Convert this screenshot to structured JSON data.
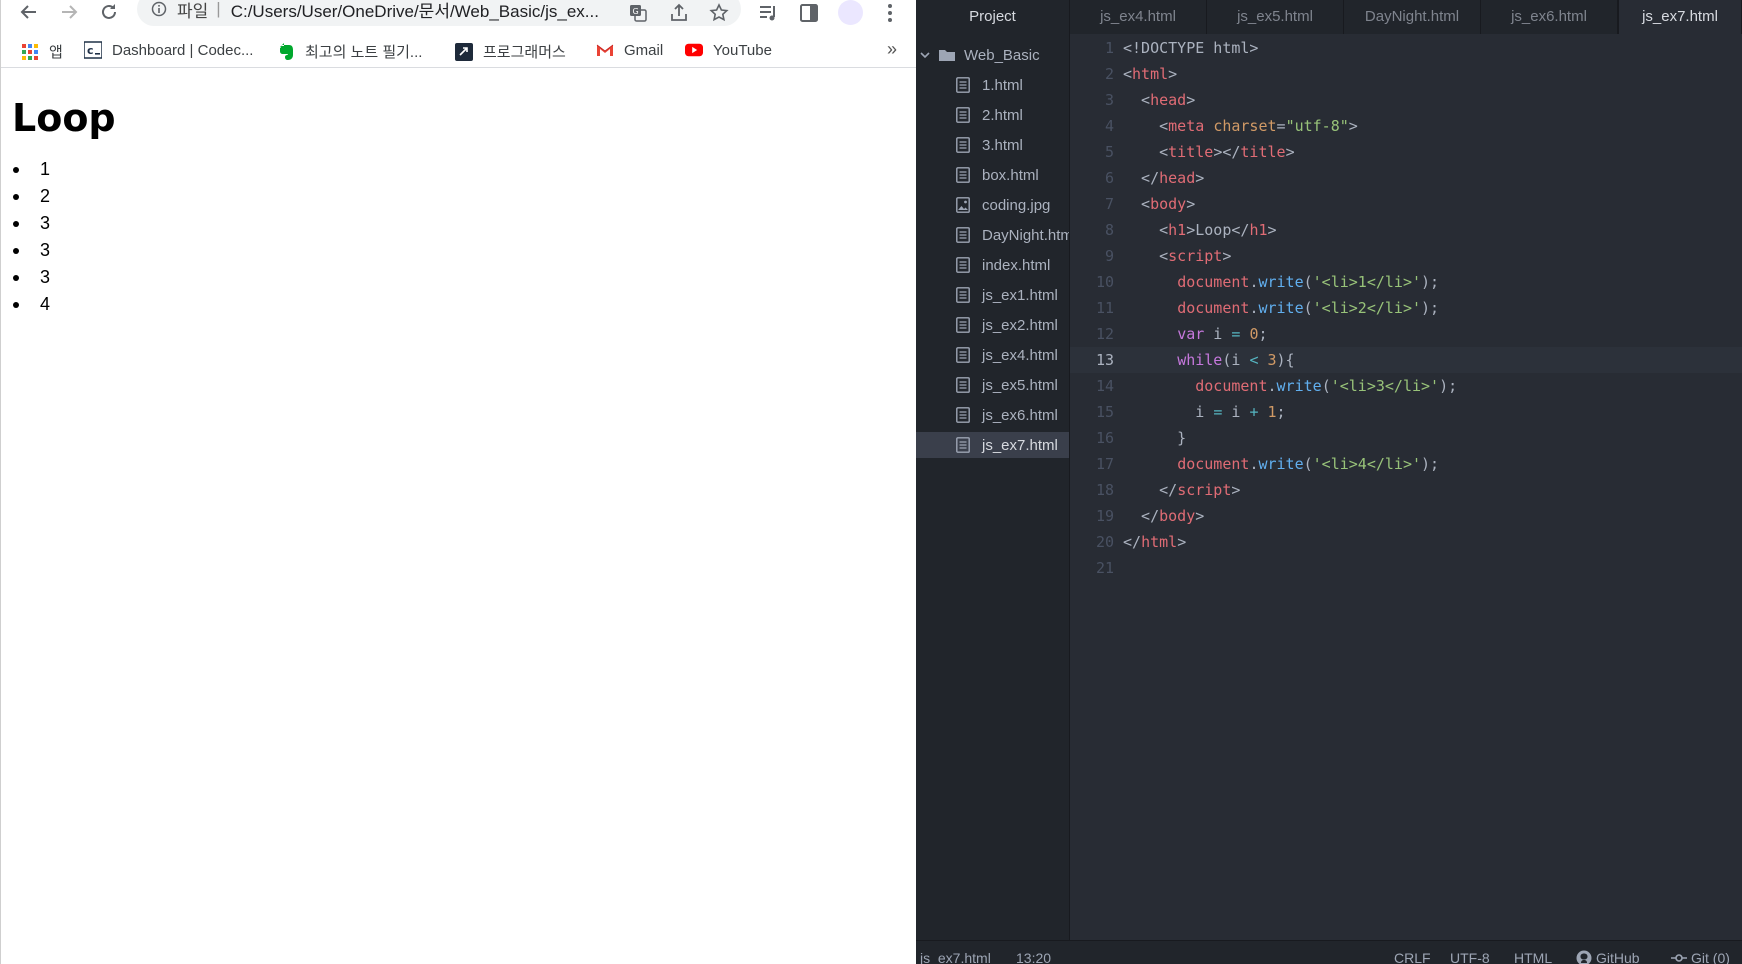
{
  "browser": {
    "address": {
      "scheme": "파일",
      "separator": "|",
      "url": "C:/Users/User/OneDrive/문서/Web_Basic/js_ex..."
    },
    "bookmarks": [
      {
        "label": "앱",
        "icon": "apps-grid-icon"
      },
      {
        "label": "Dashboard | Codec...",
        "icon": "codecademy-icon"
      },
      {
        "label": "최고의 노트 필기...",
        "icon": "evernote-icon"
      },
      {
        "label": "프로그래머스",
        "icon": "programmers-icon"
      },
      {
        "label": "Gmail",
        "icon": "gmail-icon"
      },
      {
        "label": "YouTube",
        "icon": "youtube-icon"
      }
    ],
    "bookmarks_more": "»",
    "page": {
      "heading": "Loop",
      "list": [
        "1",
        "2",
        "3",
        "3",
        "3",
        "4"
      ]
    }
  },
  "editor": {
    "tabs": [
      {
        "label": "Project"
      },
      {
        "label": "js_ex4.html"
      },
      {
        "label": "js_ex5.html"
      },
      {
        "label": "DayNight.html"
      },
      {
        "label": "js_ex6.html"
      },
      {
        "label": "js_ex7.html",
        "active": true
      }
    ],
    "tree": {
      "root": "Web_Basic",
      "files": [
        {
          "name": "1.html",
          "type": "file"
        },
        {
          "name": "2.html",
          "type": "file"
        },
        {
          "name": "3.html",
          "type": "file"
        },
        {
          "name": "box.html",
          "type": "file"
        },
        {
          "name": "coding.jpg",
          "type": "image"
        },
        {
          "name": "DayNight.html",
          "type": "file"
        },
        {
          "name": "index.html",
          "type": "file"
        },
        {
          "name": "js_ex1.html",
          "type": "file"
        },
        {
          "name": "js_ex2.html",
          "type": "file"
        },
        {
          "name": "js_ex4.html",
          "type": "file"
        },
        {
          "name": "js_ex5.html",
          "type": "file"
        },
        {
          "name": "js_ex6.html",
          "type": "file"
        },
        {
          "name": "js_ex7.html",
          "type": "file",
          "selected": true
        }
      ]
    },
    "cursor_line": 13,
    "code_lines": [
      [
        [
          "",
          "<!DOCTYPE html>"
        ]
      ],
      [
        [
          "",
          "<"
        ],
        [
          "tag",
          "html"
        ],
        [
          "",
          ">"
        ]
      ],
      [
        [
          "",
          "  <"
        ],
        [
          "tag",
          "head"
        ],
        [
          "",
          ">"
        ]
      ],
      [
        [
          "",
          "    <"
        ],
        [
          "tag",
          "meta"
        ],
        [
          "",
          " "
        ],
        [
          "attr",
          "charset"
        ],
        [
          "",
          "="
        ],
        [
          "str",
          "\"utf-8\""
        ],
        [
          "",
          ">"
        ]
      ],
      [
        [
          "",
          "    <"
        ],
        [
          "tag",
          "title"
        ],
        [
          "",
          "></"
        ],
        [
          "tag",
          "title"
        ],
        [
          "",
          ">"
        ]
      ],
      [
        [
          "",
          "  </"
        ],
        [
          "tag",
          "head"
        ],
        [
          "",
          ">"
        ]
      ],
      [
        [
          "",
          "  <"
        ],
        [
          "tag",
          "body"
        ],
        [
          "",
          ">"
        ]
      ],
      [
        [
          "",
          "    <"
        ],
        [
          "tag",
          "h1"
        ],
        [
          "",
          ">Loop</"
        ],
        [
          "tag",
          "h1"
        ],
        [
          "",
          ">"
        ]
      ],
      [
        [
          "",
          "    <"
        ],
        [
          "tag",
          "script"
        ],
        [
          "",
          ">"
        ]
      ],
      [
        [
          "",
          "      "
        ],
        [
          "tag",
          "document"
        ],
        [
          "",
          "."
        ],
        [
          "fn",
          "write"
        ],
        [
          "",
          "("
        ],
        [
          "str",
          "'<li>1</li>'"
        ],
        [
          "",
          ");"
        ]
      ],
      [
        [
          "",
          "      "
        ],
        [
          "tag",
          "document"
        ],
        [
          "",
          "."
        ],
        [
          "fn",
          "write"
        ],
        [
          "",
          "("
        ],
        [
          "str",
          "'<li>2</li>'"
        ],
        [
          "",
          ");"
        ]
      ],
      [
        [
          "",
          "      "
        ],
        [
          "kw",
          "var"
        ],
        [
          "",
          " i "
        ],
        [
          "op",
          "="
        ],
        [
          "",
          " "
        ],
        [
          "num",
          "0"
        ],
        [
          "",
          ";"
        ]
      ],
      [
        [
          "",
          "      "
        ],
        [
          "kw",
          "while"
        ],
        [
          "",
          "(i "
        ],
        [
          "op",
          "<"
        ],
        [
          "",
          " "
        ],
        [
          "num",
          "3"
        ],
        [
          "",
          "){"
        ]
      ],
      [
        [
          "",
          "        "
        ],
        [
          "tag",
          "document"
        ],
        [
          "",
          "."
        ],
        [
          "fn",
          "write"
        ],
        [
          "",
          "("
        ],
        [
          "str",
          "'<li>3</li>'"
        ],
        [
          "",
          ");"
        ]
      ],
      [
        [
          "",
          "        i "
        ],
        [
          "op",
          "="
        ],
        [
          "",
          " i "
        ],
        [
          "op",
          "+"
        ],
        [
          "",
          " "
        ],
        [
          "num",
          "1"
        ],
        [
          "",
          ";"
        ]
      ],
      [
        [
          "",
          "      }"
        ]
      ],
      [
        [
          "",
          "      "
        ],
        [
          "tag",
          "document"
        ],
        [
          "",
          "."
        ],
        [
          "fn",
          "write"
        ],
        [
          "",
          "("
        ],
        [
          "str",
          "'<li>4</li>'"
        ],
        [
          "",
          ");"
        ]
      ],
      [
        [
          "",
          "    </"
        ],
        [
          "tag",
          "script"
        ],
        [
          "",
          ">"
        ]
      ],
      [
        [
          "",
          "  </"
        ],
        [
          "tag",
          "body"
        ],
        [
          "",
          ">"
        ]
      ],
      [
        [
          "",
          "</"
        ],
        [
          "tag",
          "html"
        ],
        [
          "",
          ">"
        ]
      ],
      [
        [
          "",
          ""
        ]
      ]
    ],
    "status": {
      "file": "js_ex7.html",
      "position": "13:20",
      "line_ending": "CRLF",
      "encoding": "UTF-8",
      "grammar": "HTML",
      "github": "GitHub",
      "git": "Git (0)"
    }
  },
  "colors": {
    "editor_bg": "#282c34",
    "panel_bg": "#21252b",
    "tag": "#e06c75",
    "string": "#98c379",
    "keyword": "#c678dd",
    "function": "#61afef",
    "number": "#d19a66"
  }
}
